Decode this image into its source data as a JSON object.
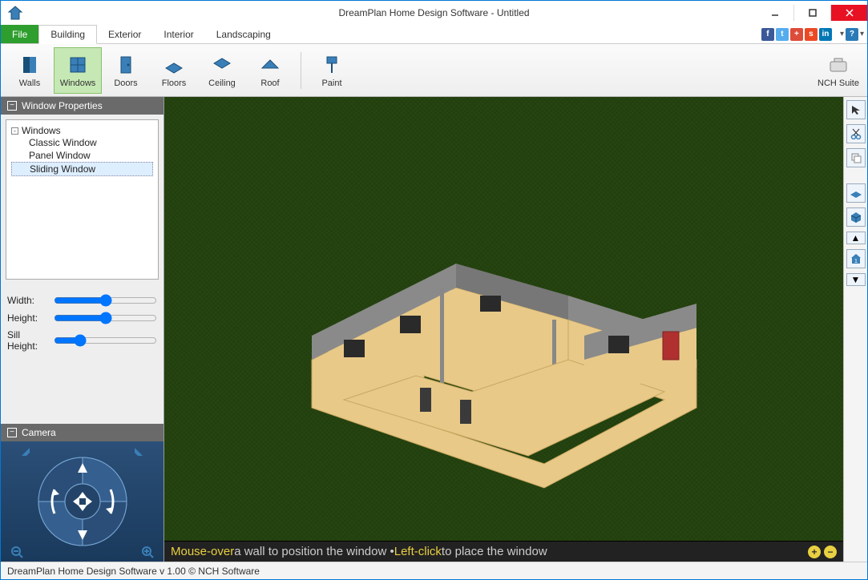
{
  "window": {
    "title": "DreamPlan Home Design Software - Untitled"
  },
  "menu": {
    "file": "File",
    "tabs": [
      "Building",
      "Exterior",
      "Interior",
      "Landscaping"
    ],
    "active_tab": "Building"
  },
  "toolbar": {
    "items": [
      {
        "label": "Walls",
        "icon": "wall-icon"
      },
      {
        "label": "Windows",
        "icon": "window-icon",
        "active": true
      },
      {
        "label": "Doors",
        "icon": "door-icon"
      },
      {
        "label": "Floors",
        "icon": "floor-icon"
      },
      {
        "label": "Ceiling",
        "icon": "ceiling-icon"
      },
      {
        "label": "Roof",
        "icon": "roof-icon"
      },
      {
        "label": "Paint",
        "icon": "paint-icon"
      }
    ],
    "suite_label": "NCH Suite"
  },
  "properties": {
    "header": "Window Properties",
    "tree_root": "Windows",
    "tree_items": [
      "Classic Window",
      "Panel Window",
      "Sliding Window"
    ],
    "selected_item": "Sliding Window",
    "sliders": [
      {
        "label": "Width:"
      },
      {
        "label": "Height:"
      },
      {
        "label": "Sill Height:"
      }
    ]
  },
  "camera": {
    "header": "Camera"
  },
  "hint": {
    "part1_hl": "Mouse-over",
    "part1_rest": " a wall to position the window • ",
    "part2_hl": "Left-click",
    "part2_rest": " to place the window"
  },
  "status": {
    "text": "DreamPlan Home Design Software v 1.00 © NCH Software"
  },
  "social_colors": {
    "fb": "#3b5998",
    "tw": "#55acee",
    "gp": "#dd4b39",
    "su": "#eb4924",
    "li": "#0077b5"
  }
}
